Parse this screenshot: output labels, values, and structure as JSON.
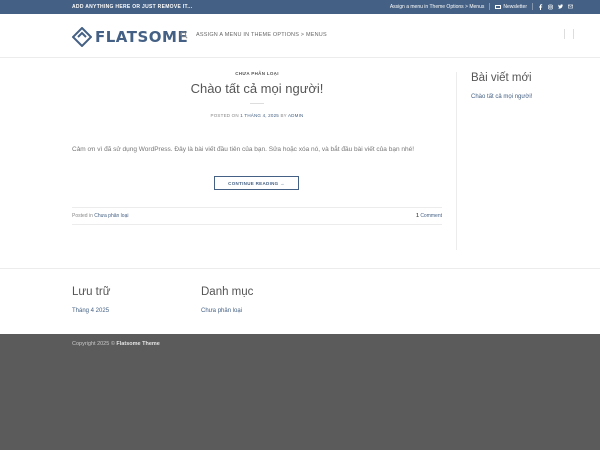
{
  "topbar": {
    "left_text": "ADD ANYTHING HERE OR JUST REMOVE IT...",
    "assign_text": "Assign a menu in Theme Options > Menus",
    "newsletter": "Newsletter",
    "social_icons": [
      "facebook-icon",
      "instagram-icon",
      "twitter-icon",
      "email-icon"
    ]
  },
  "header": {
    "logo_text": "FLATSOME",
    "nav_text": "ASSIGN A MENU IN THEME OPTIONS > MENUS"
  },
  "post": {
    "category": "CHƯA PHÂN LOẠI",
    "title": "Chào tất cả mọi người!",
    "meta_prefix": "POSTED ON",
    "date": "1 THÁNG 4, 2025",
    "by": "BY",
    "author": "ADMIN",
    "excerpt": "Cảm ơn vì đã sử dụng WordPress. Đây là bài viết đầu tiên của bạn. Sửa hoặc xóa nó, và bắt đầu bài viết của bạn nhé!",
    "continue_label": "CONTINUE READING →",
    "posted_in": "Posted in",
    "posted_in_category": "Chưa phân loại",
    "comment_count": "1",
    "comment_label": "Comment"
  },
  "sidebar": {
    "title": "Bài viết mới",
    "link": "Chào tất cả mọi người!"
  },
  "footer_widgets": {
    "archive_title": "Lưu trữ",
    "archive_link": "Tháng 4 2025",
    "category_title": "Danh mục",
    "category_link": "Chưa phân loại"
  },
  "footer": {
    "copyright_prefix": "Copyright 2025 ©",
    "copyright_brand": "Flatsome Theme"
  },
  "colors": {
    "primary": "#446084",
    "footer_bg": "#5b5b5b"
  }
}
